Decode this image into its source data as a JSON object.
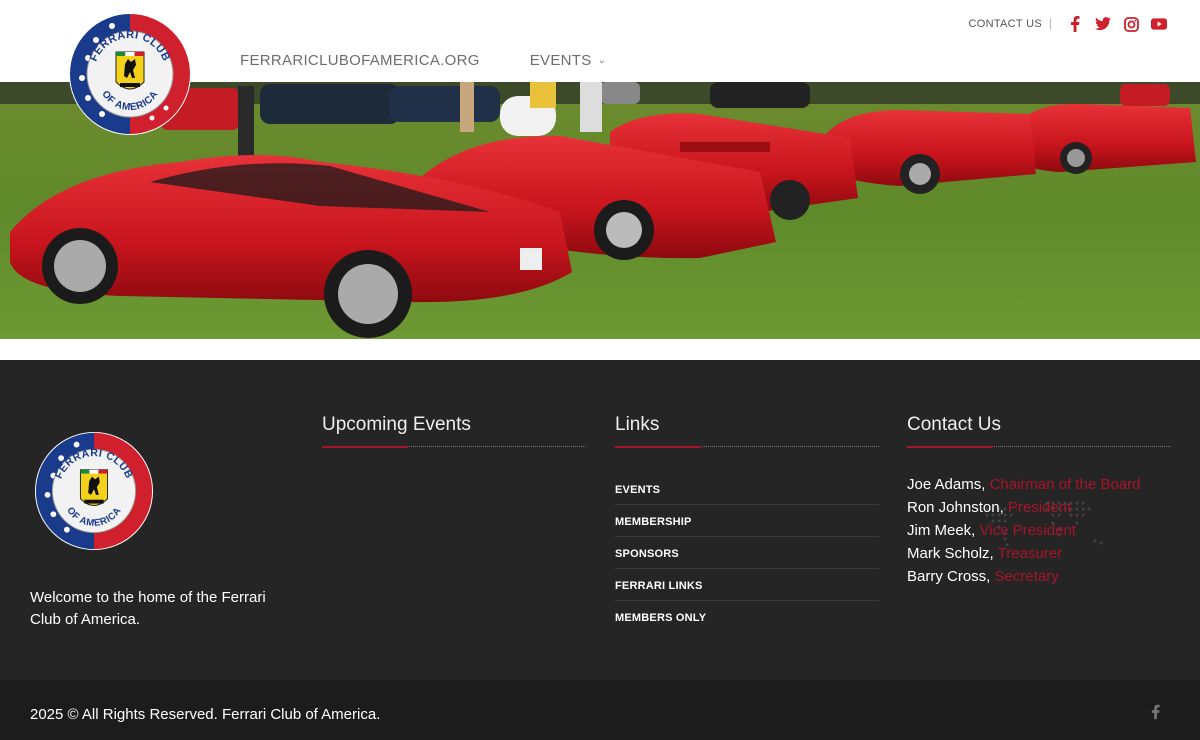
{
  "header": {
    "logo_alt": "Ferrari Club of America",
    "nav": [
      {
        "label": "FERRARICLUBOFAMERICA.ORG"
      },
      {
        "label": "EVENTS",
        "has_dropdown": true
      }
    ],
    "contact_label": "CONTACT US",
    "social": [
      "facebook-icon",
      "twitter-icon",
      "instagram-icon",
      "youtube-icon"
    ],
    "accent": "#d0202d"
  },
  "footer": {
    "welcome": "Welcome to the home of the Ferrari Club of America.",
    "events_title": "Upcoming Events",
    "links_title": "Links",
    "links": [
      "EVENTS",
      "MEMBERSHIP",
      "SPONSORS",
      "FERRARI LINKS",
      "MEMBERS ONLY"
    ],
    "contact_title": "Contact Us",
    "contacts": [
      {
        "name": "Joe Adams,",
        "role": "Chairman of the Board"
      },
      {
        "name": "Ron Johnston,",
        "role": "President"
      },
      {
        "name": "Jim Meek,",
        "role": "Vice President"
      },
      {
        "name": "Mark Scholz,",
        "role": "Treasurer"
      },
      {
        "name": "Barry Cross,",
        "role": "Secretary"
      }
    ],
    "copyright": "2025 © All Rights Reserved. Ferrari Club of America.",
    "background": "#252525",
    "accent": "#a8142a"
  }
}
